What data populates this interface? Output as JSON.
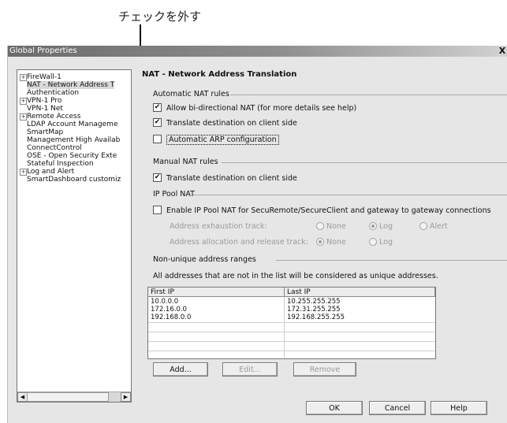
{
  "callout": {
    "text": "チェックを外す"
  },
  "window": {
    "title": "Global Properties",
    "close_glyph": "X"
  },
  "tree": {
    "items": [
      {
        "label": "FireWall-1",
        "expander": "+"
      },
      {
        "label": "NAT - Network Address T",
        "selected": true
      },
      {
        "label": "Authentication"
      },
      {
        "label": "VPN-1 Pro",
        "expander": "+"
      },
      {
        "label": "VPN-1 Net"
      },
      {
        "label": "Remote Access",
        "expander": "+"
      },
      {
        "label": "LDAP Account Manageme"
      },
      {
        "label": "SmartMap"
      },
      {
        "label": "Management High Availab"
      },
      {
        "label": "ConnectControl"
      },
      {
        "label": "OSE - Open Security Exte"
      },
      {
        "label": "Stateful Inspection"
      },
      {
        "label": "Log and Alert",
        "expander": "+"
      },
      {
        "label": "SmartDashboard customiz"
      }
    ],
    "scroll_left": "◀",
    "scroll_right": "▶"
  },
  "panel": {
    "title": "NAT - Network Address Translation",
    "auto_group": "Automatic NAT rules",
    "allow_bidirectional": "Allow bi-directional NAT (for more details see help)",
    "translate_dest_auto": "Translate destination on client side",
    "automatic_arp": "Automatic ARP configuration",
    "manual_group": "Manual NAT rules",
    "translate_dest_manual": "Translate destination on client side",
    "ippool_group": "IP Pool NAT",
    "enable_ippool": "Enable IP Pool NAT for SecuRemote/SecureClient and gateway to gateway connections",
    "exhaustion_label": "Address exhaustion track:",
    "allocation_label": "Address allocation and release track:",
    "opt_none": "None",
    "opt_log": "Log",
    "opt_alert": "Alert",
    "nonunique_group": "Non-unique address ranges",
    "nonunique_desc": "All addresses that are not in the list will be considered as unique addresses."
  },
  "table": {
    "headers": [
      "First IP",
      "Last IP"
    ],
    "rows": [
      [
        "10.0.0.0",
        "10.255.255.255"
      ],
      [
        "172.16.0.0",
        "172.31.255.255"
      ],
      [
        "192.168.0.0",
        "192.168.255.255"
      ]
    ]
  },
  "buttons": {
    "add": "Add...",
    "edit": "Edit...",
    "remove": "Remove",
    "ok": "OK",
    "cancel": "Cancel",
    "help": "Help"
  }
}
